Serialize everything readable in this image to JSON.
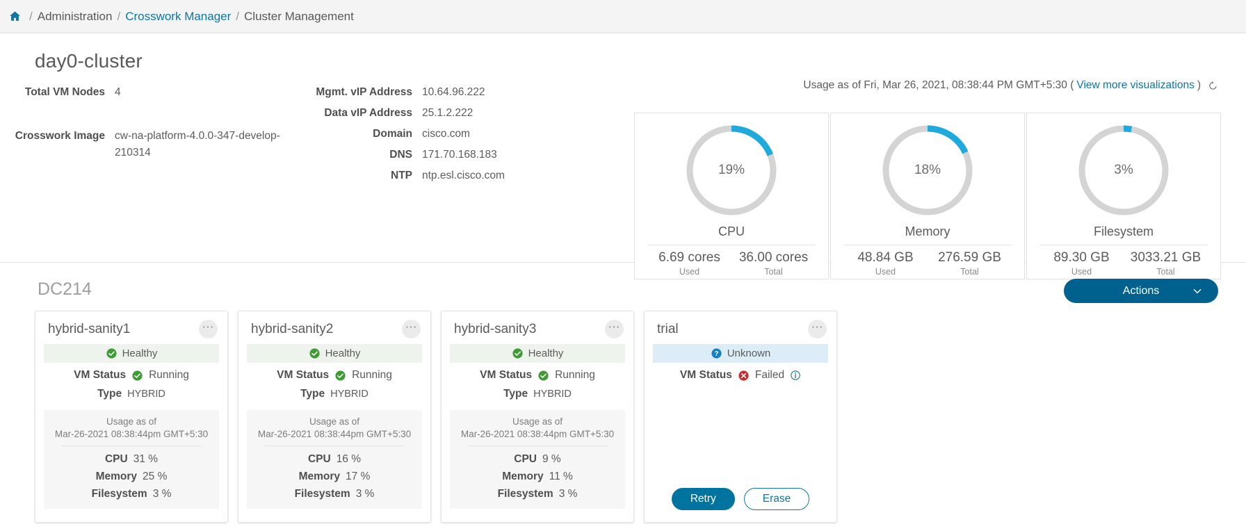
{
  "breadcrumb": {
    "home_icon": "home-icon",
    "items": [
      {
        "label": "Administration",
        "link": false
      },
      {
        "label": "Crosswork Manager",
        "link": true
      },
      {
        "label": "Cluster Management",
        "link": false
      }
    ],
    "separator": "/"
  },
  "cluster": {
    "title": "day0-cluster",
    "info_left": [
      {
        "label": "Total VM Nodes",
        "value": "4"
      },
      {
        "label": "Crosswork Image",
        "value": "cw-na-platform-4.0.0-347-develop-210314"
      }
    ],
    "info_right": [
      {
        "label": "Mgmt. vIP Address",
        "value": "10.64.96.222"
      },
      {
        "label": "Data vIP Address",
        "value": "25.1.2.222"
      },
      {
        "label": "Domain",
        "value": "cisco.com"
      },
      {
        "label": "DNS",
        "value": "171.70.168.183"
      },
      {
        "label": "NTP",
        "value": "ntp.esl.cisco.com"
      }
    ]
  },
  "usage_header": {
    "text": "Usage as of Fri, Mar 26, 2021, 08:38:44 PM GMT+5:30 (",
    "link": "View more visualizations",
    "close_paren": ")",
    "refresh_icon": "refresh-icon"
  },
  "chart_data": [
    {
      "type": "pie",
      "title": "CPU",
      "percent": 19,
      "percent_label": "19%",
      "used": "6.69 cores",
      "total": "36.00 cores",
      "used_caption": "Used",
      "total_caption": "Total",
      "arc_color": "#1eaadc",
      "track_color": "#d4d4d4"
    },
    {
      "type": "pie",
      "title": "Memory",
      "percent": 18,
      "percent_label": "18%",
      "used": "48.84 GB",
      "total": "276.59 GB",
      "used_caption": "Used",
      "total_caption": "Total",
      "arc_color": "#1eaadc",
      "track_color": "#d4d4d4"
    },
    {
      "type": "pie",
      "title": "Filesystem",
      "percent": 3,
      "percent_label": "3%",
      "used": "89.30 GB",
      "total": "3033.21 GB",
      "used_caption": "Used",
      "total_caption": "Total",
      "arc_color": "#1eaadc",
      "track_color": "#d4d4d4"
    }
  ],
  "dc": {
    "title": "DC214",
    "actions_label": "Actions",
    "actions_caret_icon": "chevron-down-icon",
    "actions_color": "#00618e"
  },
  "nodes": [
    {
      "name": "hybrid-sanity1",
      "kebab_icon": "kebab-menu-icon",
      "health": "Healthy",
      "health_icon": "check-circle-icon",
      "health_state": "healthy",
      "vm_status_label": "VM Status",
      "vm_status": "Running",
      "vm_status_icon": "check-circle-icon",
      "type_label": "Type",
      "type": "HYBRID",
      "usage_title": "Usage as of",
      "usage_ts": "Mar-26-2021 08:38:44pm GMT+5:30",
      "metrics": [
        {
          "label": "CPU",
          "value": "31 %"
        },
        {
          "label": "Memory",
          "value": "25 %"
        },
        {
          "label": "Filesystem",
          "value": "3 %"
        }
      ]
    },
    {
      "name": "hybrid-sanity2",
      "kebab_icon": "kebab-menu-icon",
      "health": "Healthy",
      "health_icon": "check-circle-icon",
      "health_state": "healthy",
      "vm_status_label": "VM Status",
      "vm_status": "Running",
      "vm_status_icon": "check-circle-icon",
      "type_label": "Type",
      "type": "HYBRID",
      "usage_title": "Usage as of",
      "usage_ts": "Mar-26-2021 08:38:44pm GMT+5:30",
      "metrics": [
        {
          "label": "CPU",
          "value": "16 %"
        },
        {
          "label": "Memory",
          "value": "17 %"
        },
        {
          "label": "Filesystem",
          "value": "3 %"
        }
      ]
    },
    {
      "name": "hybrid-sanity3",
      "kebab_icon": "kebab-menu-icon",
      "health": "Healthy",
      "health_icon": "check-circle-icon",
      "health_state": "healthy",
      "vm_status_label": "VM Status",
      "vm_status": "Running",
      "vm_status_icon": "check-circle-icon",
      "type_label": "Type",
      "type": "HYBRID",
      "usage_title": "Usage as of",
      "usage_ts": "Mar-26-2021 08:38:44pm GMT+5:30",
      "metrics": [
        {
          "label": "CPU",
          "value": "9 %"
        },
        {
          "label": "Memory",
          "value": "11 %"
        },
        {
          "label": "Filesystem",
          "value": "3 %"
        }
      ]
    }
  ],
  "trial_node": {
    "name": "trial",
    "kebab_icon": "kebab-menu-icon",
    "health": "Unknown",
    "health_icon": "question-circle-icon",
    "vm_status_label": "VM Status",
    "vm_status": "Failed",
    "vm_status_icon": "error-circle-icon",
    "info_icon": "info-circle-icon",
    "retry_label": "Retry",
    "erase_label": "Erase"
  },
  "colors": {
    "accent_blue": "#0d77a4",
    "gauge_blue": "#1eaadc",
    "healthy_green": "#3f9c35",
    "failed_red": "#cc2b2b",
    "unknown_blue": "#1581c4"
  }
}
